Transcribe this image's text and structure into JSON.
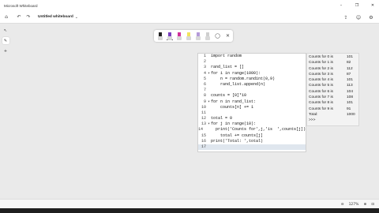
{
  "app": {
    "title": "Microsoft Whiteboard"
  },
  "window_controls": {
    "minimize": "–",
    "restore": "❐",
    "close": "✕"
  },
  "nav": {
    "home_icon": "⌂",
    "undo_icon": "↶",
    "redo_icon": "↷",
    "doc_title": "Untitled whiteboard",
    "doc_chevron": "⌄",
    "share_icon": "⇪",
    "settings_icon": "⚙",
    "account_icon": "☺"
  },
  "left_rail": {
    "select_icon": "↖",
    "pen_icon": "✎",
    "add_icon": "+"
  },
  "toolbar": {
    "pens": [
      {
        "name": "black-pen",
        "color": "#222222"
      },
      {
        "name": "purple-pen",
        "color": "#7a3fc0"
      },
      {
        "name": "magenta-pen",
        "color": "#d0309a"
      },
      {
        "name": "yellow-highlighter",
        "color": "#f2e35c"
      },
      {
        "name": "violet-highlighter",
        "color": "#b49ad8"
      },
      {
        "name": "eraser",
        "color": "#cfcfcf"
      }
    ],
    "lasso_icon": "◯",
    "close_icon": "✕"
  },
  "code": {
    "lines": [
      {
        "n": "1",
        "fold": "",
        "text": "import random"
      },
      {
        "n": "2",
        "fold": "",
        "text": ""
      },
      {
        "n": "3",
        "fold": "",
        "text": "rand_list = []"
      },
      {
        "n": "4",
        "fold": "▾",
        "text": "for i in range(1000):"
      },
      {
        "n": "5",
        "fold": "",
        "text": "    n = random.randint(0,9)"
      },
      {
        "n": "6",
        "fold": "",
        "text": "    rand_list.append(n)"
      },
      {
        "n": "7",
        "fold": "",
        "text": ""
      },
      {
        "n": "8",
        "fold": "",
        "text": "counts = [0]*10"
      },
      {
        "n": "9",
        "fold": "▾",
        "text": "for n in rand_list:"
      },
      {
        "n": "10",
        "fold": "",
        "text": "    counts[n] += 1"
      },
      {
        "n": "11",
        "fold": "",
        "text": ""
      },
      {
        "n": "12",
        "fold": "",
        "text": "total = 0"
      },
      {
        "n": "13",
        "fold": "▾",
        "text": "for j in range(10):"
      },
      {
        "n": "14",
        "fold": "",
        "text": "    print('Counts for',j,'is  ',counts[j])"
      },
      {
        "n": "15",
        "fold": "",
        "text": "    total += counts[j]"
      },
      {
        "n": "16",
        "fold": "",
        "text": "print('Total: ',total)"
      },
      {
        "n": "17",
        "fold": "",
        "text": ""
      }
    ]
  },
  "output": {
    "rows": [
      {
        "label": "Counts for 0 is",
        "value": "101"
      },
      {
        "label": "Counts for 1 is",
        "value": "82"
      },
      {
        "label": "Counts for 2 is",
        "value": "112"
      },
      {
        "label": "Counts for 3 is",
        "value": "87"
      },
      {
        "label": "Counts for 4 is",
        "value": "101"
      },
      {
        "label": "Counts for 5 is",
        "value": "113"
      },
      {
        "label": "Counts for 6 is",
        "value": "104"
      },
      {
        "label": "Counts for 7 is",
        "value": "108"
      },
      {
        "label": "Counts for 8 is",
        "value": "101"
      },
      {
        "label": "Counts for 9 is",
        "value": "91"
      },
      {
        "label": "Total:",
        "value": "1000"
      }
    ],
    "prompt": ">>>"
  },
  "status": {
    "zoom_out_icon": "⊖",
    "zoom": "127%",
    "zoom_in_icon": "⊕",
    "fit_icon": "⊡"
  }
}
